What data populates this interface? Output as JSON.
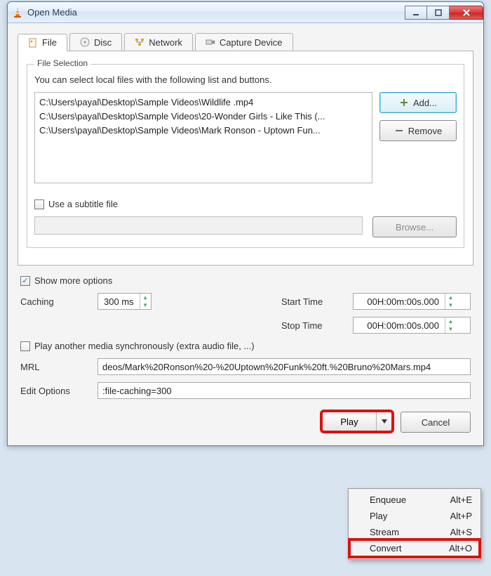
{
  "window": {
    "title": "Open Media"
  },
  "tabs": {
    "file": "File",
    "disc": "Disc",
    "network": "Network",
    "capture": "Capture Device"
  },
  "fileselection": {
    "legend": "File Selection",
    "hint": "You can select local files with the following list and buttons.",
    "files": [
      "C:\\Users\\payal\\Desktop\\Sample Videos\\Wildlife .mp4",
      "C:\\Users\\payal\\Desktop\\Sample Videos\\20-Wonder Girls - Like This (...",
      "C:\\Users\\payal\\Desktop\\Sample Videos\\Mark Ronson - Uptown Fun..."
    ],
    "add": "Add...",
    "remove": "Remove"
  },
  "subtitle": {
    "label": "Use a subtitle file",
    "browse": "Browse..."
  },
  "moreopts": "Show more options",
  "caching": {
    "label": "Caching",
    "value": "300 ms"
  },
  "start": {
    "label": "Start Time",
    "value": "00H:00m:00s.000"
  },
  "stop": {
    "label": "Stop Time",
    "value": "00H:00m:00s.000"
  },
  "sync": "Play another media synchronously (extra audio file, ...)",
  "mrl": {
    "label": "MRL",
    "value": "deos/Mark%20Ronson%20-%20Uptown%20Funk%20ft.%20Bruno%20Mars.mp4"
  },
  "edit": {
    "label": "Edit Options",
    "value": ":file-caching=300"
  },
  "footer": {
    "play": "Play",
    "cancel": "Cancel"
  },
  "menu": [
    {
      "label": "Enqueue",
      "accel": "Alt+E"
    },
    {
      "label": "Play",
      "accel": "Alt+P"
    },
    {
      "label": "Stream",
      "accel": "Alt+S"
    },
    {
      "label": "Convert",
      "accel": "Alt+O"
    }
  ]
}
